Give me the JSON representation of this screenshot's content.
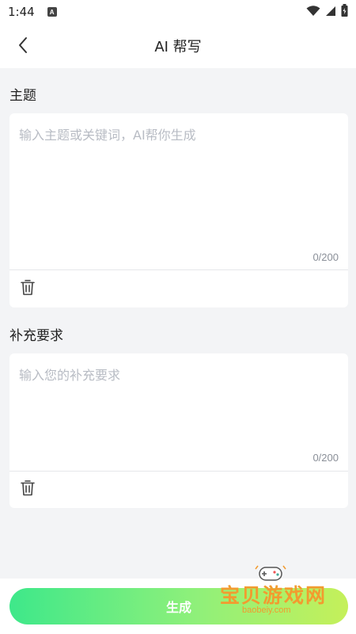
{
  "status_bar": {
    "time": "1:44",
    "app_icon_letter": "A",
    "icons": [
      "wifi-icon",
      "signal-icon",
      "battery-icon"
    ]
  },
  "header": {
    "title": "AI 帮写",
    "back_icon": "chevron-left-icon"
  },
  "topic": {
    "label": "主题",
    "placeholder": "输入主题或关键词，AI帮你生成",
    "value": "",
    "counter": "0/200",
    "clear_icon": "trash-icon"
  },
  "requirements": {
    "label": "补充要求",
    "placeholder": "输入您的补充要求",
    "value": "",
    "counter": "0/200",
    "clear_icon": "trash-icon"
  },
  "footer": {
    "generate_label": "生成"
  },
  "watermark": {
    "text": "宝贝游戏网",
    "url": "baobeiy.com"
  },
  "colors": {
    "background": "#f3f4f6",
    "card": "#ffffff",
    "button_gradient_start": "#3ee88a",
    "button_gradient_end": "#c5f05a",
    "placeholder": "#b8bcc4",
    "counter": "#8a8f98",
    "watermark": "#f29b2f"
  }
}
